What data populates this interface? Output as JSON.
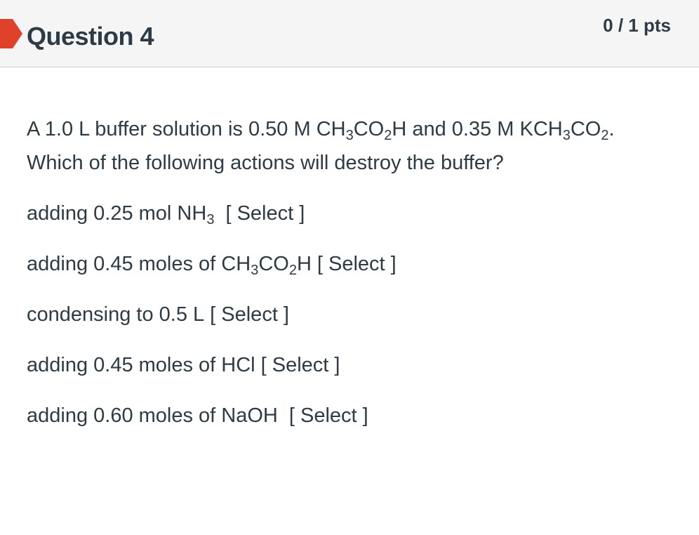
{
  "question": {
    "title": "Question 4",
    "points": "0 / 1 pts"
  },
  "prompt": {
    "part1": "A 1.0 L buffer solution is 0.50 M CH",
    "sub1": "3",
    "part2": "CO",
    "sub2": "2",
    "part3": "H and 0.35 M KCH",
    "sub3": "3",
    "part4": "CO",
    "sub4": "2",
    "part5": ". Which of the following actions will destroy the buffer?"
  },
  "items": [
    {
      "pre": "adding 0.25 mol NH",
      "sub": "3",
      "select": "[ Select ]"
    },
    {
      "pre": "adding 0.45 moles of CH",
      "sub_a": "3",
      "mid": "CO",
      "sub_b": "2",
      "post": "H",
      "select": "[ Select ]"
    },
    {
      "text": "condensing to 0.5 L",
      "select": "[ Select ]"
    },
    {
      "text": "adding 0.45 moles of HCl",
      "select": "[ Select ]"
    },
    {
      "text": "adding 0.60 moles of NaOH",
      "select": "[ Select ]"
    }
  ],
  "colors": {
    "flag": "#e0412b",
    "header_bg": "#f5f5f5",
    "text": "#2d3b45"
  }
}
